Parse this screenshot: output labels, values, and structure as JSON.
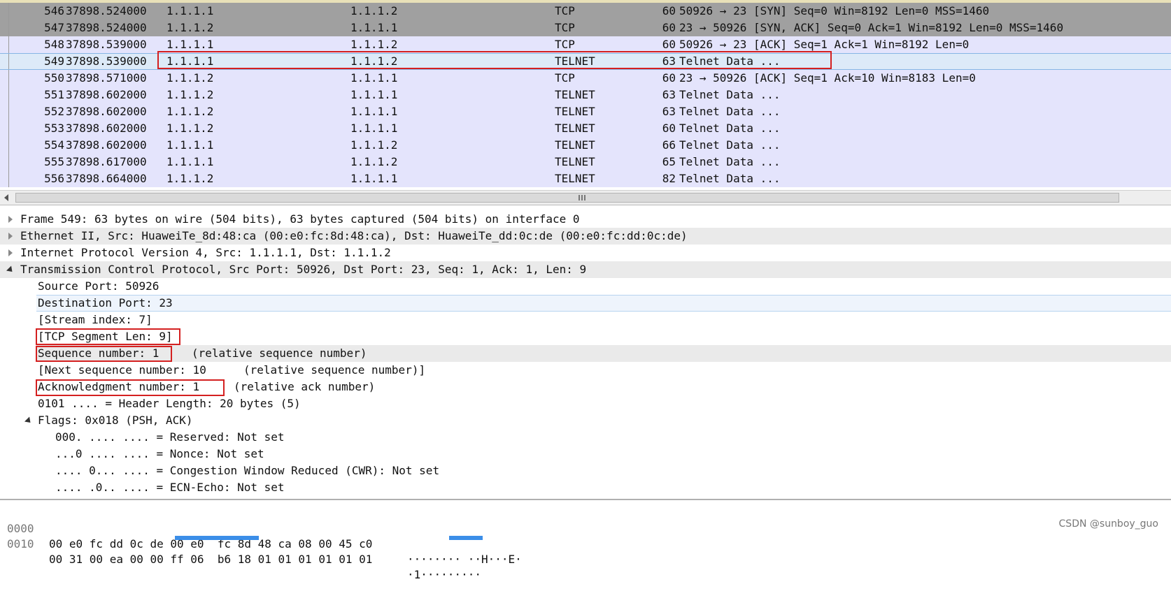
{
  "packets": [
    {
      "no": "546",
      "time": "37898.524000",
      "src": "1.1.1.1",
      "dst": "1.1.1.2",
      "proto": "TCP",
      "len": "60",
      "info": "50926 → 23 [SYN] Seq=0 Win=8192 Len=0 MSS=1460"
    },
    {
      "no": "547",
      "time": "37898.524000",
      "src": "1.1.1.2",
      "dst": "1.1.1.1",
      "proto": "TCP",
      "len": "60",
      "info": "23 → 50926 [SYN, ACK] Seq=0 Ack=1 Win=8192 Len=0 MSS=1460"
    },
    {
      "no": "548",
      "time": "37898.539000",
      "src": "1.1.1.1",
      "dst": "1.1.1.2",
      "proto": "TCP",
      "len": "60",
      "info": "50926 → 23 [ACK] Seq=1 Ack=1 Win=8192 Len=0"
    },
    {
      "no": "549",
      "time": "37898.539000",
      "src": "1.1.1.1",
      "dst": "1.1.1.2",
      "proto": "TELNET",
      "len": "63",
      "info": "Telnet Data ..."
    },
    {
      "no": "550",
      "time": "37898.571000",
      "src": "1.1.1.2",
      "dst": "1.1.1.1",
      "proto": "TCP",
      "len": "60",
      "info": "23 → 50926 [ACK] Seq=1 Ack=10 Win=8183 Len=0"
    },
    {
      "no": "551",
      "time": "37898.602000",
      "src": "1.1.1.2",
      "dst": "1.1.1.1",
      "proto": "TELNET",
      "len": "63",
      "info": "Telnet Data ..."
    },
    {
      "no": "552",
      "time": "37898.602000",
      "src": "1.1.1.2",
      "dst": "1.1.1.1",
      "proto": "TELNET",
      "len": "63",
      "info": "Telnet Data ..."
    },
    {
      "no": "553",
      "time": "37898.602000",
      "src": "1.1.1.2",
      "dst": "1.1.1.1",
      "proto": "TELNET",
      "len": "60",
      "info": "Telnet Data ..."
    },
    {
      "no": "554",
      "time": "37898.602000",
      "src": "1.1.1.1",
      "dst": "1.1.1.2",
      "proto": "TELNET",
      "len": "66",
      "info": "Telnet Data ..."
    },
    {
      "no": "555",
      "time": "37898.617000",
      "src": "1.1.1.1",
      "dst": "1.1.1.2",
      "proto": "TELNET",
      "len": "65",
      "info": "Telnet Data ..."
    },
    {
      "no": "556",
      "time": "37898.664000",
      "src": "1.1.1.2",
      "dst": "1.1.1.1",
      "proto": "TELNET",
      "len": "82",
      "info": "Telnet Data ..."
    }
  ],
  "details": {
    "frame": "Frame 549: 63 bytes on wire (504 bits), 63 bytes captured (504 bits) on interface 0",
    "ethernet": "Ethernet II, Src: HuaweiTe_8d:48:ca (00:e0:fc:8d:48:ca), Dst: HuaweiTe_dd:0c:de (00:e0:fc:dd:0c:de)",
    "ip": "Internet Protocol Version 4, Src: 1.1.1.1, Dst: 1.1.1.2",
    "tcp": "Transmission Control Protocol, Src Port: 50926, Dst Port: 23, Seq: 1, Ack: 1, Len: 9",
    "src_port": "Source Port: 50926",
    "dst_port": "Destination Port: 23",
    "stream_index": "[Stream index: 7]",
    "seg_len": "[TCP Segment Len: 9]",
    "seq_label": "Sequence number: 1",
    "seq_note": "(relative sequence number)",
    "next_seq_label": "[Next sequence number: 10",
    "next_seq_note": "(relative sequence number)]",
    "ack_label": "Acknowledgment number: 1",
    "ack_note": "(relative ack number)",
    "header_len": "0101 .... = Header Length: 20 bytes (5)",
    "flags": "Flags: 0x018 (PSH, ACK)",
    "reserved": "000. .... .... = Reserved: Not set",
    "nonce": "...0 .... .... = Nonce: Not set",
    "cwr": ".... 0... .... = Congestion Window Reduced (CWR): Not set",
    "ecn": ".... .0.. .... = ECN-Echo: Not set"
  },
  "hex": [
    {
      "offset": "0000",
      "bytes": "00 e0 fc dd 0c de 00 e0  fc 8d 48 ca 08 00 45 c0",
      "ascii": "········ ··H···E·"
    },
    {
      "offset": "0010",
      "bytes": "00 31 00 ea 00 00 ff 06  b6 18 01 01 01 01 01 01",
      "ascii": "·1·········"
    }
  ],
  "watermark": "CSDN @sunboy_guo",
  "colors": {
    "gray_row": "#a0a0a0",
    "lavender_row": "#e4e4fc",
    "selected_row": "#ddeaf8",
    "annotation": "#d42020"
  }
}
